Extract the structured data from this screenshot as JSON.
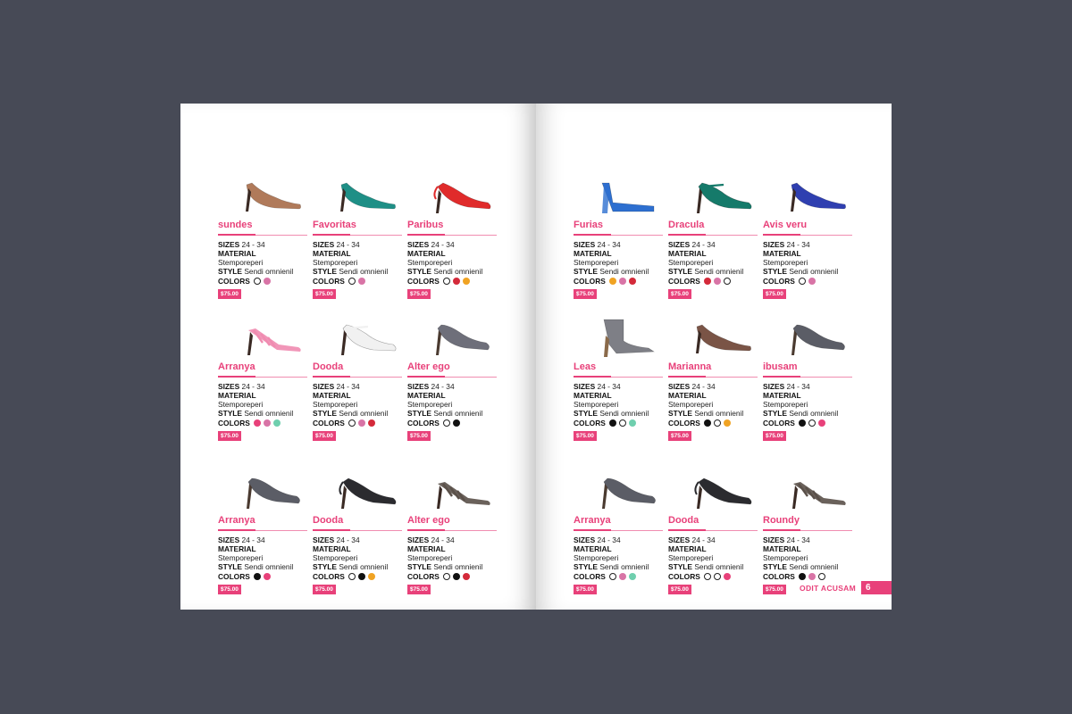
{
  "labels": {
    "sizes": "SIZES",
    "material": "MATERIAL",
    "style": "STYLE",
    "colors": "COLORS"
  },
  "theme": {
    "accent": "#e8417a"
  },
  "footer": {
    "title": "ODIT ACUSAM",
    "page_number": "6"
  },
  "left_page": {
    "products": [
      {
        "name": "sundes",
        "sizes": "24 - 34",
        "material": "Stemporeperi",
        "style": "Sendi omnienil",
        "price": "$75.00",
        "colors": [
          "#ffffff",
          "#d874a6"
        ],
        "shoe": {
          "type": "pump",
          "color": "#b07a5a"
        }
      },
      {
        "name": "Favoritas",
        "sizes": "24 - 34",
        "material": "Stemporeperi",
        "style": "Sendi omnienil",
        "price": "$75.00",
        "colors": [
          "#ffffff",
          "#d874a6"
        ],
        "shoe": {
          "type": "pump",
          "color": "#1e8f86"
        }
      },
      {
        "name": "Paribus",
        "sizes": "24 - 34",
        "material": "Stemporeperi",
        "style": "Sendi omnienil",
        "price": "$75.00",
        "colors": [
          "#ffffff",
          "#d42a3a",
          "#f0a323"
        ],
        "shoe": {
          "type": "slingback",
          "color": "#e02b2b"
        }
      },
      {
        "name": "Arranya",
        "sizes": "24 - 34",
        "material": "Stemporeperi",
        "style": "Sendi omnienil",
        "price": "$75.00",
        "colors": [
          "#e8417a",
          "#d874a6",
          "#6fcfae"
        ],
        "shoe": {
          "type": "strappy",
          "color": "#f08bb0"
        }
      },
      {
        "name": "Dooda",
        "sizes": "24 - 34",
        "material": "Stemporeperi",
        "style": "Sendi omnienil",
        "price": "$75.00",
        "colors": [
          "#ffffff",
          "#d874a6",
          "#d42a3a"
        ],
        "shoe": {
          "type": "strap",
          "color": "#f1f1f1"
        }
      },
      {
        "name": "Alter ego",
        "sizes": "24 - 34",
        "material": "Stemporeperi",
        "style": "Sendi omnienil",
        "price": "$75.00",
        "colors": [
          "#ffffff",
          "#111111"
        ],
        "shoe": {
          "type": "peep",
          "color": "#6e6f7a"
        }
      },
      {
        "name": "Arranya",
        "sizes": "24 - 34",
        "material": "Stemporeperi",
        "style": "Sendi omnienil",
        "price": "$75.00",
        "colors": [
          "#111111",
          "#e8417a"
        ],
        "shoe": {
          "type": "peep",
          "color": "#5b5d66"
        }
      },
      {
        "name": "Dooda",
        "sizes": "24 - 34",
        "material": "Stemporeperi",
        "style": "Sendi omnienil",
        "price": "$75.00",
        "colors": [
          "#ffffff",
          "#111111",
          "#f0a323"
        ],
        "shoe": {
          "type": "slingback",
          "color": "#2b2b2f"
        }
      },
      {
        "name": "Alter ego",
        "sizes": "24 - 34",
        "material": "Stemporeperi",
        "style": "Sendi omnienil",
        "price": "$75.00",
        "colors": [
          "#ffffff",
          "#111111",
          "#d42a3a"
        ],
        "shoe": {
          "type": "strappy",
          "color": "#5a5049"
        }
      }
    ]
  },
  "right_page": {
    "products": [
      {
        "name": "Furias",
        "sizes": "24 - 34",
        "material": "Stemporeperi",
        "style": "Sendi omnienil",
        "price": "$75.00",
        "colors": [
          "#f0a323",
          "#d874a6",
          "#d42a3a"
        ],
        "shoe": {
          "type": "platform",
          "color": "#2d6fd0"
        }
      },
      {
        "name": "Dracula",
        "sizes": "24 - 34",
        "material": "Stemporeperi",
        "style": "Sendi omnienil",
        "price": "$75.00",
        "colors": [
          "#d42a3a",
          "#d874a6",
          "#ffffff"
        ],
        "shoe": {
          "type": "strap",
          "color": "#157a6a"
        }
      },
      {
        "name": "Avis veru",
        "sizes": "24 - 34",
        "material": "Stemporeperi",
        "style": "Sendi omnienil",
        "price": "$75.00",
        "colors": [
          "#ffffff",
          "#d874a6"
        ],
        "shoe": {
          "type": "pump",
          "color": "#2f3fb0"
        }
      },
      {
        "name": "Leas",
        "sizes": "24 - 34",
        "material": "Stemporeperi",
        "style": "Sendi omnienil",
        "price": "$75.00",
        "colors": [
          "#111111",
          "#ffffff",
          "#6fcfae"
        ],
        "shoe": {
          "type": "boot",
          "color": "#7e7f86"
        }
      },
      {
        "name": "Marianna",
        "sizes": "24 - 34",
        "material": "Stemporeperi",
        "style": "Sendi omnienil",
        "price": "$75.00",
        "colors": [
          "#111111",
          "#ffffff",
          "#f0a323"
        ],
        "shoe": {
          "type": "pump",
          "color": "#7a5446"
        }
      },
      {
        "name": "ibusam",
        "sizes": "24 - 34",
        "material": "Stemporeperi",
        "style": "Sendi omnienil",
        "price": "$75.00",
        "colors": [
          "#111111",
          "#ffffff",
          "#e8417a"
        ],
        "shoe": {
          "type": "peep",
          "color": "#5b5d66"
        }
      },
      {
        "name": "Arranya",
        "sizes": "24 - 34",
        "material": "Stemporeperi",
        "style": "Sendi omnienil",
        "price": "$75.00",
        "colors": [
          "#ffffff",
          "#d874a6",
          "#6fcfae"
        ],
        "shoe": {
          "type": "peep",
          "color": "#5b5d66"
        }
      },
      {
        "name": "Dooda",
        "sizes": "24 - 34",
        "material": "Stemporeperi",
        "style": "Sendi omnienil",
        "price": "$75.00",
        "colors": [
          "#ffffff",
          "#ffffff",
          "#e8417a"
        ],
        "shoe": {
          "type": "slingback",
          "color": "#2b2b2f"
        }
      },
      {
        "name": "Roundy",
        "sizes": "24 - 34",
        "material": "Stemporeperi",
        "style": "Sendi omnienil",
        "price": "$75.00",
        "colors": [
          "#111111",
          "#d874a6",
          "#ffffff"
        ],
        "shoe": {
          "type": "strappy",
          "color": "#5a5049"
        }
      }
    ]
  }
}
